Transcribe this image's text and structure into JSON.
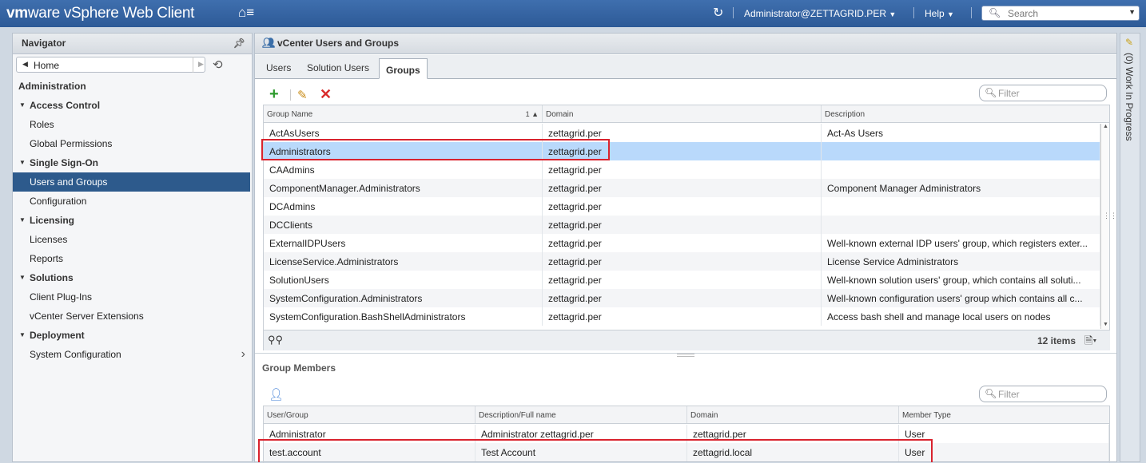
{
  "app": {
    "brand_vm": "vm",
    "brand_ware": "ware",
    "brand_product": "vSphere Web Client",
    "user": "Administrator@ZETTAGRID.PER",
    "help": "Help",
    "search_placeholder": "Search"
  },
  "navigator": {
    "title": "Navigator",
    "home": "Home",
    "section": "Administration",
    "rows": [
      {
        "label": "Access Control",
        "kind": "group"
      },
      {
        "label": "Roles",
        "kind": "item"
      },
      {
        "label": "Global Permissions",
        "kind": "item"
      },
      {
        "label": "Single Sign-On",
        "kind": "group"
      },
      {
        "label": "Users and Groups",
        "kind": "item",
        "selected": true
      },
      {
        "label": "Configuration",
        "kind": "item"
      },
      {
        "label": "Licensing",
        "kind": "group"
      },
      {
        "label": "Licenses",
        "kind": "item"
      },
      {
        "label": "Reports",
        "kind": "item"
      },
      {
        "label": "Solutions",
        "kind": "group"
      },
      {
        "label": "Client Plug-Ins",
        "kind": "item"
      },
      {
        "label": "vCenter Server Extensions",
        "kind": "item"
      },
      {
        "label": "Deployment",
        "kind": "group"
      },
      {
        "label": "System Configuration",
        "kind": "item",
        "has_submenu": true
      }
    ]
  },
  "main": {
    "title": "vCenter Users and Groups",
    "tabs": [
      "Users",
      "Solution Users",
      "Groups"
    ],
    "active_tab": "Groups",
    "filter_placeholder": "Filter",
    "groups_table": {
      "columns": [
        "Group Name",
        "Domain",
        "Description"
      ],
      "sort_indicator": "1 ▲",
      "rows": [
        [
          "ActAsUsers",
          "zettagrid.per",
          "Act-As Users"
        ],
        [
          "Administrators",
          "zettagrid.per",
          ""
        ],
        [
          "CAAdmins",
          "zettagrid.per",
          ""
        ],
        [
          "ComponentManager.Administrators",
          "zettagrid.per",
          "Component Manager Administrators"
        ],
        [
          "DCAdmins",
          "zettagrid.per",
          ""
        ],
        [
          "DCClients",
          "zettagrid.per",
          ""
        ],
        [
          "ExternalIDPUsers",
          "zettagrid.per",
          "Well-known external IDP users' group, which registers exter..."
        ],
        [
          "LicenseService.Administrators",
          "zettagrid.per",
          "License Service Administrators"
        ],
        [
          "SolutionUsers",
          "zettagrid.per",
          "Well-known solution users' group, which contains all soluti..."
        ],
        [
          "SystemConfiguration.Administrators",
          "zettagrid.per",
          "Well-known configuration users' group which contains all c..."
        ],
        [
          "SystemConfiguration.BashShellAdministrators",
          "zettagrid.per",
          "Access bash shell and manage local users on nodes"
        ]
      ],
      "selected_row": 1,
      "item_count": "12 items"
    },
    "members": {
      "title": "Group Members",
      "filter_placeholder": "Filter",
      "columns": [
        "User/Group",
        "Description/Full name",
        "Domain",
        "Member Type"
      ],
      "rows": [
        [
          "Administrator",
          "Administrator zettagrid.per",
          "zettagrid.per",
          "User"
        ],
        [
          "test.account",
          "Test Account",
          "zettagrid.local",
          "User"
        ]
      ]
    }
  },
  "side_panel": {
    "label": "(0) Work In Progress"
  }
}
